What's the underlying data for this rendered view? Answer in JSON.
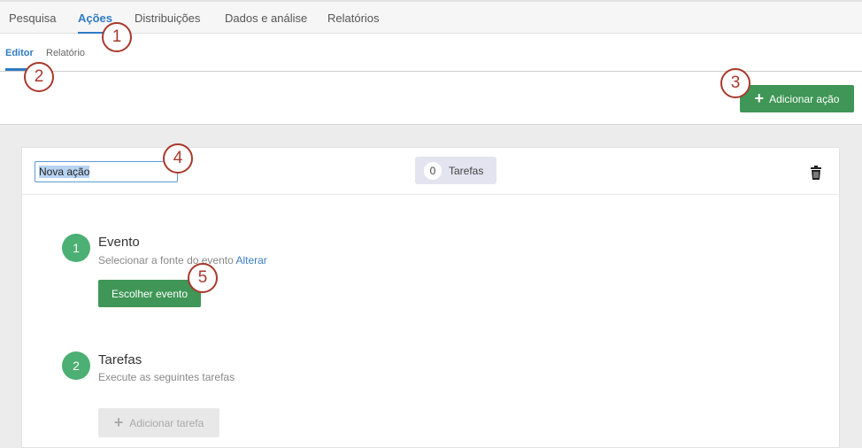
{
  "top_nav": {
    "tabs": [
      "Pesquisa",
      "Ações",
      "Distribuições",
      "Dados e análise",
      "Relatórios"
    ],
    "active": "Ações"
  },
  "sub_nav": {
    "tabs": [
      "Editor",
      "Relatório"
    ],
    "active": "Editor"
  },
  "toolbar": {
    "add_action_label": "Adicionar ação"
  },
  "action_card": {
    "name_value": "Nova ação",
    "tasks_count": "0",
    "tasks_label": "Tarefas",
    "steps": [
      {
        "number": "1",
        "title": "Evento",
        "description": "Selecionar a fonte do evento",
        "link": "Alterar",
        "button": "Escolher evento"
      },
      {
        "number": "2",
        "title": "Tarefas",
        "description": "Execute as seguintes tarefas",
        "button": "Adicionar tarefa"
      }
    ]
  },
  "callouts": [
    "1",
    "2",
    "3",
    "4",
    "5"
  ],
  "colors": {
    "accent": "#2f7bc4",
    "green": "#3f9656",
    "step_green": "#4caf73",
    "callout": "#a8392c"
  }
}
